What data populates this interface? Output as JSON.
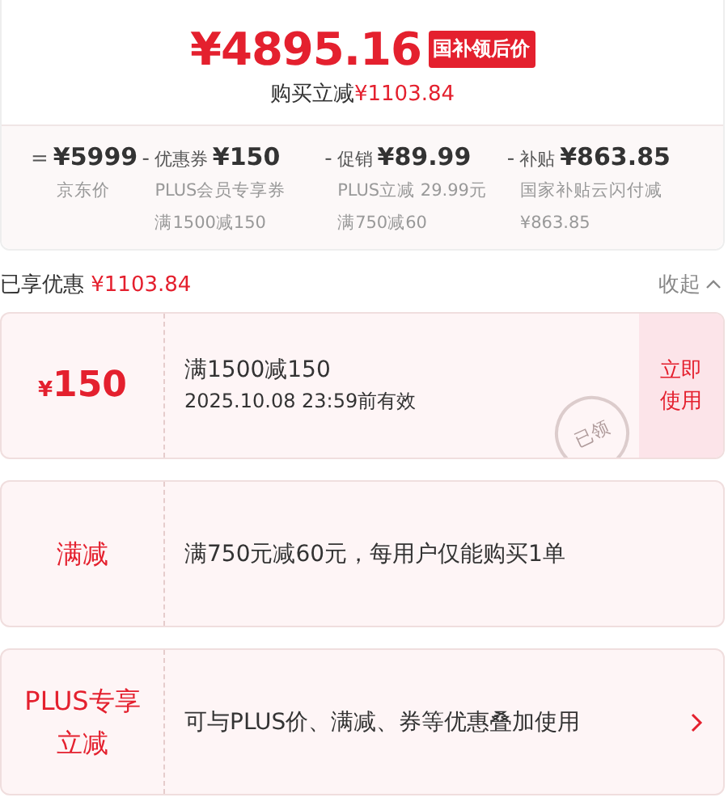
{
  "summary": {
    "price": "¥4895.16",
    "price_tag": "国补领后价",
    "saving_label": "购买立减",
    "saving_amount": "¥1103.84"
  },
  "breakdown": [
    {
      "op": "=",
      "amount": "¥5999",
      "notes": [
        "京东价"
      ]
    },
    {
      "op": "-",
      "label": "优惠券",
      "amount": "¥150",
      "notes": [
        "PLUS会员专享券",
        "满1500减150"
      ]
    },
    {
      "op": "-",
      "label": "促销",
      "amount": "¥89.99",
      "notes": [
        "PLUS立减 29.99元",
        "满750减60"
      ]
    },
    {
      "op": "-",
      "label": "补贴",
      "amount": "¥863.85",
      "notes": [
        "国家补贴云闪付减",
        "¥863.85"
      ]
    }
  ],
  "enjoyed": {
    "label": "已享优惠",
    "amount": "¥1103.84",
    "collapse": "收起"
  },
  "offers": [
    {
      "kind": "coupon",
      "currency": "¥",
      "amount": "150",
      "title": "满1500减150",
      "subtitle": "2025.10.08 23:59前有效",
      "stamp": "已领",
      "action": "立即使用"
    },
    {
      "kind": "promo",
      "label": "满减",
      "text": "满750元减60元，每用户仅能购买1单",
      "chevron": false
    },
    {
      "kind": "promo",
      "label": "PLUS专享立减",
      "text": "可与PLUS价、满减、券等优惠叠加使用",
      "chevron": true
    }
  ]
}
